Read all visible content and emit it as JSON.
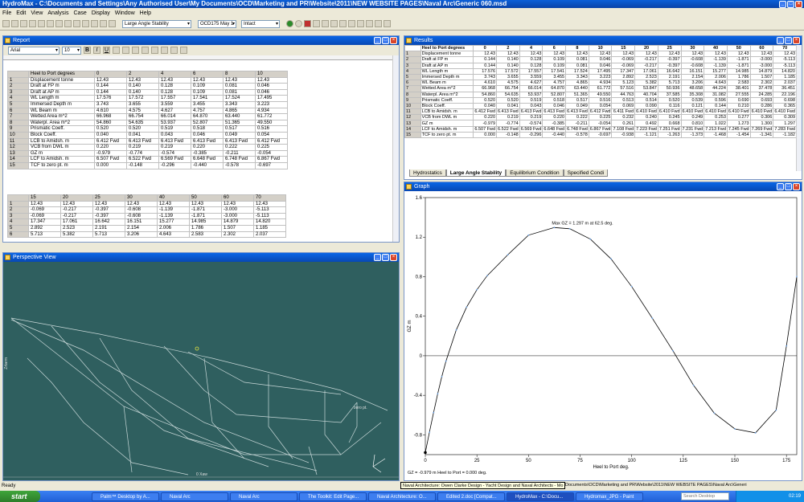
{
  "app": {
    "title": "HydroMax - C:\\Documents and Settings\\Any Authorised User\\My Documents\\OCD\\Marketing and PR\\Website\\2011\\NEW WEBSITE PAGES\\Naval Arc\\Generic 060.msd"
  },
  "menu": [
    "File",
    "Edit",
    "View",
    "Analysis",
    "Case",
    "Display",
    "Window",
    "Help"
  ],
  "toolbar": {
    "analysis": "Large Angle Stability",
    "loadcase": "OCD175 May 1",
    "condition": "Intact"
  },
  "report": {
    "title": "Report",
    "font": "Arial",
    "size": "10",
    "table1": {
      "header": [
        "Heel to Port degrees",
        "0",
        "2",
        "4",
        "6",
        "8",
        "10"
      ],
      "rows": [
        [
          "1",
          "Displacement tonne",
          "12.43",
          "12.43",
          "12.43",
          "12.43",
          "12.43",
          "12.43"
        ],
        [
          "2",
          "Draft at FP m",
          "0.144",
          "0.140",
          "0.128",
          "0.109",
          "0.081",
          "0.046"
        ],
        [
          "3",
          "Draft at AP m",
          "0.144",
          "0.140",
          "0.128",
          "0.109",
          "0.081",
          "0.046"
        ],
        [
          "4",
          "WL Length m",
          "17.576",
          "17.572",
          "17.557",
          "17.541",
          "17.524",
          "17.495"
        ],
        [
          "5",
          "Immersed Depth m",
          "3.743",
          "3.655",
          "3.559",
          "3.455",
          "3.343",
          "3.223"
        ],
        [
          "6",
          "WL Beam m",
          "4.610",
          "4.575",
          "4.627",
          "4.757",
          "4.865",
          "4.934"
        ],
        [
          "7",
          "Wetted Area m^2",
          "66.968",
          "66.754",
          "66.014",
          "64.870",
          "63.440",
          "61.772"
        ],
        [
          "8",
          "Waterpl. Area m^2",
          "54.860",
          "54.635",
          "53.937",
          "52.807",
          "51.365",
          "49.550"
        ],
        [
          "9",
          "Prismatic Coeff.",
          "0.520",
          "0.520",
          "0.519",
          "0.518",
          "0.517",
          "0.516"
        ],
        [
          "10",
          "Block Coeff.",
          "0.040",
          "0.041",
          "0.043",
          "0.046",
          "0.049",
          "0.054"
        ],
        [
          "11",
          "LCB to Amidsh. m",
          "6.412 Fwd",
          "6.413 Fwd",
          "6.413 Fwd",
          "6.413 Fwd",
          "6.413 Fwd",
          "6.412 Fwd"
        ],
        [
          "12",
          "VCB from DWL m",
          "0.220",
          "0.219",
          "0.219",
          "0.220",
          "0.222",
          "0.225"
        ],
        [
          "13",
          "GZ m",
          "-0.979",
          "-0.774",
          "-0.574",
          "-0.385",
          "-0.211",
          "-0.054"
        ],
        [
          "14",
          "LCF to Amidsh. m",
          "6.507 Fwd",
          "6.522 Fwd",
          "6.569 Fwd",
          "6.648 Fwd",
          "6.748 Fwd",
          "6.867 Fwd"
        ],
        [
          "15",
          "TCF to zero pt. m",
          "0.000",
          "-0.148",
          "-0.296",
          "-0.440",
          "-0.578",
          "-0.697"
        ]
      ]
    },
    "table2": {
      "header": [
        "",
        "15",
        "20",
        "25",
        "30",
        "40",
        "50",
        "60",
        "70"
      ],
      "rows": [
        [
          "1",
          "12.43",
          "12.43",
          "12.43",
          "12.43",
          "12.43",
          "12.43",
          "12.43",
          "12.43"
        ],
        [
          "2",
          "-0.069",
          "-0.217",
          "-0.397",
          "-0.608",
          "-1.139",
          "-1.871",
          "-3.000",
          "-5.113"
        ],
        [
          "3",
          "-0.069",
          "-0.217",
          "-0.397",
          "-0.608",
          "-1.139",
          "-1.871",
          "-3.000",
          "-5.113"
        ],
        [
          "4",
          "17.347",
          "17.061",
          "16.642",
          "16.151",
          "15.277",
          "14.985",
          "14.879",
          "14.820"
        ],
        [
          "5",
          "2.892",
          "2.523",
          "2.191",
          "2.154",
          "2.006",
          "1.786",
          "1.507",
          "1.185"
        ],
        [
          "6",
          "5.713",
          "5.382",
          "5.713",
          "3.206",
          "4.643",
          "2.583",
          "2.302",
          "2.037"
        ]
      ]
    }
  },
  "results": {
    "title": "Results",
    "header": [
      "Heel to Port degrees",
      "0",
      "2",
      "4",
      "6",
      "8",
      "10",
      "15",
      "20",
      "25",
      "30",
      "40",
      "50",
      "60",
      "70"
    ],
    "rows": [
      [
        "1",
        "Displacement tonne",
        "12.43",
        "12.43",
        "12.43",
        "12.43",
        "12.43",
        "12.43",
        "12.43",
        "12.43",
        "12.43",
        "12.43",
        "12.43",
        "12.43",
        "12.43",
        "12.43"
      ],
      [
        "2",
        "Draft at FP m",
        "0.144",
        "0.140",
        "0.128",
        "0.109",
        "0.081",
        "0.046",
        "-0.069",
        "-0.217",
        "-0.397",
        "-0.608",
        "-1.139",
        "-1.871",
        "-3.000",
        "-5.113"
      ],
      [
        "3",
        "Draft at AP m",
        "0.144",
        "0.140",
        "0.128",
        "0.109",
        "0.081",
        "0.046",
        "-0.069",
        "-0.217",
        "-0.397",
        "-0.608",
        "-1.139",
        "-1.871",
        "-3.000",
        "-5.113"
      ],
      [
        "4",
        "WL Length m",
        "17.576",
        "17.572",
        "17.557",
        "17.541",
        "17.524",
        "17.495",
        "17.347",
        "17.061",
        "16.642",
        "16.151",
        "15.277",
        "14.985",
        "14.879",
        "14.820"
      ],
      [
        "5",
        "Immersed Depth m",
        "3.743",
        "3.655",
        "3.559",
        "3.455",
        "3.343",
        "3.223",
        "2.892",
        "2.523",
        "2.191",
        "2.154",
        "2.006",
        "1.786",
        "1.507",
        "1.185"
      ],
      [
        "6",
        "WL Beam m",
        "4.610",
        "4.575",
        "4.627",
        "4.757",
        "4.865",
        "4.934",
        "5.123",
        "5.382",
        "5.713",
        "3.206",
        "4.643",
        "2.583",
        "2.302",
        "2.037"
      ],
      [
        "7",
        "Wetted Area m^2",
        "66.968",
        "66.754",
        "66.014",
        "64.870",
        "63.440",
        "61.772",
        "57.516",
        "53.847",
        "50.936",
        "48.658",
        "44.224",
        "38.401",
        "37.478",
        "36.451"
      ],
      [
        "8",
        "Waterpl. Area m^2",
        "54.860",
        "54.635",
        "53.937",
        "52.807",
        "51.365",
        "49.550",
        "44.763",
        "40.704",
        "37.585",
        "35.308",
        "31.082",
        "27.555",
        "24.285",
        "22.196"
      ],
      [
        "9",
        "Prismatic Coeff.",
        "0.520",
        "0.520",
        "0.519",
        "0.518",
        "0.517",
        "0.516",
        "0.513",
        "0.514",
        "0.520",
        "0.539",
        "0.596",
        "0.690",
        "0.693",
        "0.698"
      ],
      [
        "10",
        "Block Coeff.",
        "0.040",
        "0.041",
        "0.043",
        "0.046",
        "0.049",
        "0.054",
        "0.069",
        "0.090",
        "0.116",
        "0.121",
        "0.144",
        "0.210",
        "0.286",
        "0.365"
      ],
      [
        "11",
        "LCB to Amidsh. m",
        "6.412 Fwd",
        "6.413 Fwd",
        "6.413 Fwd",
        "6.413 Fwd",
        "6.413 Fwd",
        "6.412 Fwd",
        "6.411 Fwd",
        "6.410 Fwd",
        "6.410 Fwd",
        "6.410 Fwd",
        "6.410 Fwd",
        "6.410 Fwd",
        "6.410 Fwd",
        "6.410 Fwd"
      ],
      [
        "12",
        "VCB from DWL m",
        "0.220",
        "0.219",
        "0.219",
        "0.220",
        "0.222",
        "0.225",
        "0.232",
        "0.240",
        "0.245",
        "0.249",
        "0.253",
        "0.277",
        "0.306",
        "0.309"
      ],
      [
        "13",
        "GZ m",
        "-0.979",
        "-0.774",
        "-0.574",
        "-0.385",
        "-0.211",
        "-0.054",
        "0.261",
        "0.492",
        "0.668",
        "0.810",
        "1.022",
        "1.273",
        "1.300",
        "1.297"
      ],
      [
        "14",
        "LCF to Amidsh. m",
        "6.507 Fwd",
        "6.522 Fwd",
        "6.569 Fwd",
        "6.648 Fwd",
        "6.748 Fwd",
        "6.867 Fwd",
        "7.108 Fwd",
        "7.223 Fwd",
        "7.251 Fwd",
        "7.231 Fwd",
        "7.213 Fwd",
        "7.245 Fwd",
        "7.269 Fwd",
        "7.283 Fwd"
      ],
      [
        "15",
        "TCF to zero pt. m",
        "0.000",
        "-0.148",
        "-0.296",
        "-0.440",
        "-0.578",
        "-0.697",
        "-0.938",
        "-1.121",
        "-1.263",
        "-1.373",
        "-1.468",
        "-1.454",
        "-1.341",
        "-1.182"
      ]
    ],
    "tabs": [
      "Hydrostatics",
      "Large Angle Stability",
      "Equilibrium Condition",
      "Specified Condi"
    ]
  },
  "perspective": {
    "title": "Perspective View",
    "xaxis": "0 Xaw",
    "yaxis": "Zrtarm",
    "zero_pt": "zero pt."
  },
  "graph": {
    "title": "Graph",
    "annotation": "Max GZ = 1.297 m at 62.5 deg.",
    "footer": "GZ = -0.979 m      Heel to Port = 0.000 deg."
  },
  "chart_data": {
    "type": "line",
    "title": "",
    "xlabel": "Heel to Port  deg.",
    "ylabel": "GZ  m",
    "xlim": [
      0,
      180
    ],
    "ylim": [
      -1.0,
      1.6
    ],
    "xticks": [
      "0",
      "25",
      "50",
      "75",
      "100",
      "125",
      "150",
      "175"
    ],
    "yticks": [
      "-0.8",
      "-0.4",
      "0",
      "0.4",
      "0.8",
      "1.2",
      "1.6"
    ],
    "series": [
      {
        "x": [
          0,
          2,
          4,
          6,
          8,
          10,
          15,
          20,
          25,
          30,
          40,
          50,
          62.5,
          70,
          80,
          90,
          100,
          110,
          120,
          130,
          140,
          150,
          160,
          170,
          175,
          180
        ],
        "y": [
          -0.979,
          -0.774,
          -0.574,
          -0.385,
          -0.211,
          -0.054,
          0.261,
          0.492,
          0.668,
          0.81,
          1.022,
          1.22,
          1.297,
          1.285,
          1.18,
          0.98,
          0.7,
          0.38,
          0.05,
          -0.3,
          -0.58,
          -0.74,
          -0.78,
          -0.55,
          0.1,
          0.8
        ]
      }
    ]
  },
  "status": {
    "left": "Ready",
    "tooltip": "Naval Architecture: Owen Clarke Design - Yacht Design and Naval Architects - Mo",
    "path": "Documents\\OCD\\Marketing and PR\\Website\\2011\\NEW WEBSITE PAGES\\Naval Arc\\Generi"
  },
  "taskbar": {
    "start": "start",
    "items": [
      "Palm™ Desktop by A...",
      "Naval Arc",
      "Naval Arc",
      "The Toolkit: Edit Page...",
      "Naval Architecture: O...",
      "Edited 2.doc [Compat...",
      "HydroMax - C:\\Docu...",
      "Hydromax_JPG - Paint"
    ],
    "search": "Search Desktop",
    "clock": "02:19"
  }
}
